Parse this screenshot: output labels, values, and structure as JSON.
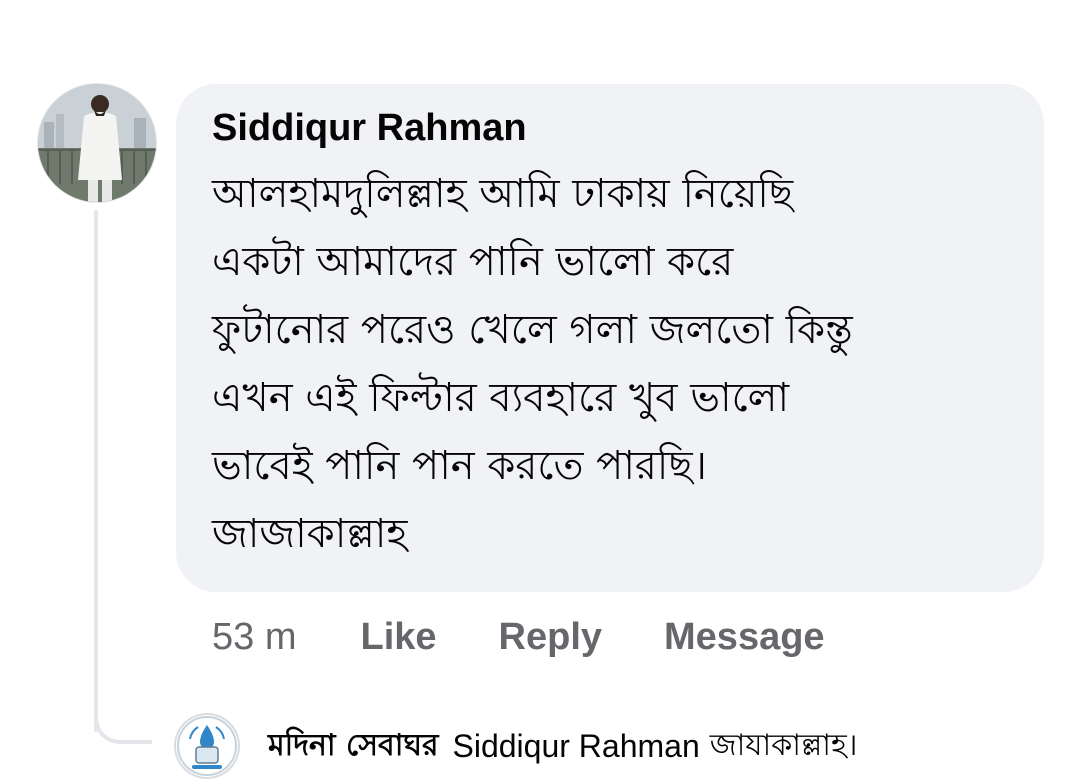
{
  "comment": {
    "author": "Siddiqur Rahman",
    "avatar": "profile-photo-avatar",
    "lines": [
      "আলহামদুলিল্লাহ আমি ঢাকায় নিয়েছি",
      "একটা আমাদের পানি ভালো করে",
      "ফুটানোর পরেও খেলে গলা জলতো কিন্তু",
      "এখন এই ফিল্টার ব্যবহারে খুব ভালো",
      "ভাবেই পানি পান করতে পারছি।",
      "জাজাকাল্লাহ"
    ],
    "bubble_color": "#f0f2f5"
  },
  "actions": {
    "timestamp": "53 m",
    "like": "Like",
    "reply": "Reply",
    "message": "Message"
  },
  "reply": {
    "author": "মদিনা সেবাঘর",
    "mention": "Siddiqur Rahman",
    "text": "জাযাকাল্লাহ।",
    "avatar": "page-logo-avatar"
  },
  "colors": {
    "text_primary": "#050505",
    "text_secondary": "#65676b",
    "thread_line": "#e4e6eb"
  }
}
